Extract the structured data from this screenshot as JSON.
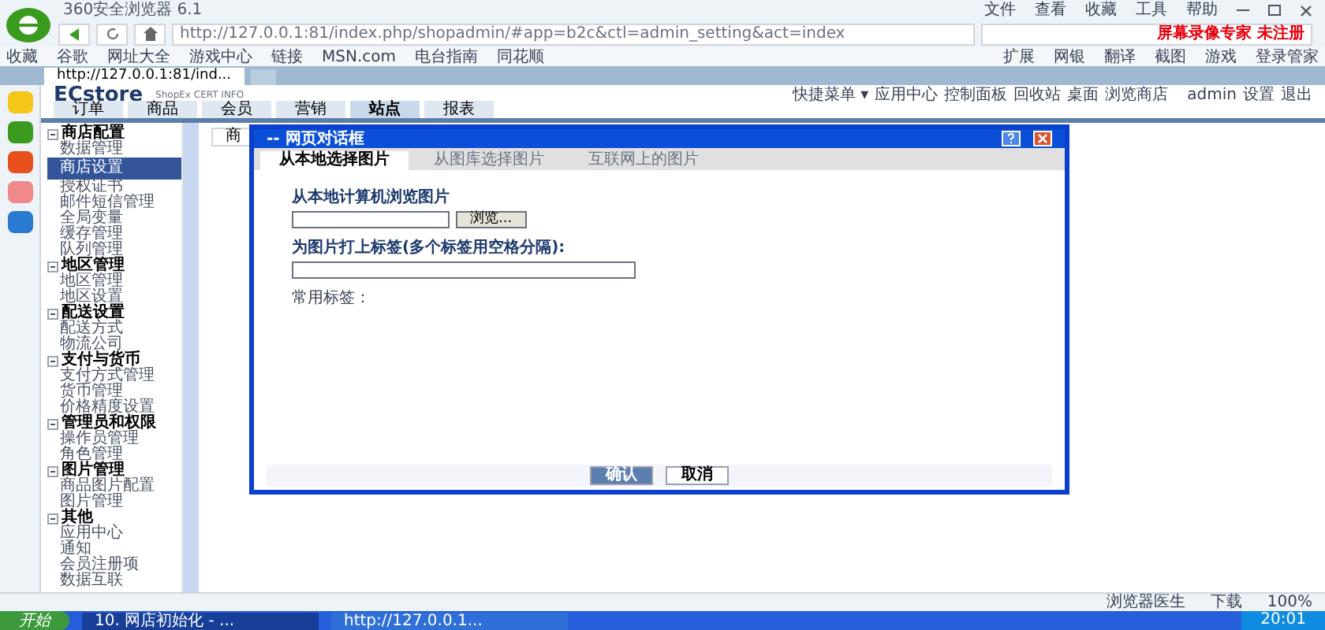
{
  "browser": {
    "title": "360安全浏览器 6.1",
    "menu": [
      "文件",
      "查看",
      "收藏",
      "工具",
      "帮助"
    ],
    "url": "http://127.0.0.1:81/index.php/shopadmin/#app=b2c&ctl=admin_setting&act=index",
    "watermark_notice": "屏幕录像专家 未注册",
    "bookmarks": [
      "收藏",
      "谷歌",
      "网址大全",
      "游戏中心",
      "链接",
      "MSN.com",
      "电台指南",
      "同花顺"
    ],
    "extensions": [
      "扩展",
      "网银",
      "翻译",
      "截图",
      "游戏",
      "登录管家"
    ],
    "tabs": [
      {
        "label": "http://127.0.0.1:81/ind...",
        "selected": true
      }
    ]
  },
  "app": {
    "logo": "ECstore",
    "logo_sub": "ShopEx CERT INFO",
    "top_links": [
      "快捷菜单 ▾",
      "应用中心",
      "控制面板",
      "回收站",
      "桌面",
      "浏览商店"
    ],
    "user": "admin",
    "user_links": [
      "设置",
      "退出"
    ],
    "nav": [
      {
        "label": "订单",
        "selected": false
      },
      {
        "label": "商品",
        "selected": false
      },
      {
        "label": "会员",
        "selected": false
      },
      {
        "label": "营销",
        "selected": false
      },
      {
        "label": "站点",
        "selected": true
      },
      {
        "label": "报表",
        "selected": false
      }
    ],
    "content_tab": "商",
    "sidebar": [
      {
        "title": "商店配置",
        "expanded": true,
        "items": [
          {
            "label": "数据管理",
            "selected": false
          },
          {
            "label": "商店设置",
            "selected": true
          },
          {
            "label": "授权证书",
            "selected": false
          },
          {
            "label": "邮件短信管理",
            "selected": false
          },
          {
            "label": "全局变量",
            "selected": false
          },
          {
            "label": "缓存管理",
            "selected": false
          },
          {
            "label": "队列管理",
            "selected": false
          }
        ]
      },
      {
        "title": "地区管理",
        "expanded": true,
        "items": [
          {
            "label": "地区管理",
            "selected": false
          },
          {
            "label": "地区设置",
            "selected": false
          }
        ]
      },
      {
        "title": "配送设置",
        "expanded": true,
        "items": [
          {
            "label": "配送方式",
            "selected": false
          },
          {
            "label": "物流公司",
            "selected": false
          }
        ]
      },
      {
        "title": "支付与货币",
        "expanded": true,
        "items": [
          {
            "label": "支付方式管理",
            "selected": false
          },
          {
            "label": "货币管理",
            "selected": false
          },
          {
            "label": "价格精度设置",
            "selected": false
          }
        ]
      },
      {
        "title": "管理员和权限",
        "expanded": true,
        "items": [
          {
            "label": "操作员管理",
            "selected": false
          },
          {
            "label": "角色管理",
            "selected": false
          }
        ]
      },
      {
        "title": "图片管理",
        "expanded": true,
        "items": [
          {
            "label": "商品图片配置",
            "selected": false
          },
          {
            "label": "图片管理",
            "selected": false
          }
        ]
      },
      {
        "title": "其他",
        "expanded": true,
        "items": [
          {
            "label": "应用中心",
            "selected": false
          },
          {
            "label": "通知",
            "selected": false
          },
          {
            "label": "会员注册项",
            "selected": false
          },
          {
            "label": "数据互联",
            "selected": false
          }
        ]
      }
    ]
  },
  "dialog": {
    "title": "-- 网页对话框",
    "tabs": [
      {
        "label": "从本地选择图片",
        "selected": true
      },
      {
        "label": "从图库选择图片",
        "selected": false
      },
      {
        "label": "互联网上的图片",
        "selected": false
      }
    ],
    "file_label": "从本地计算机浏览图片",
    "browse_button": "浏览...",
    "tags_label": "为图片打上标签(多个标签用空格分隔):",
    "common_tags": "常用标签：",
    "buttons": [
      "确认",
      "取消"
    ]
  },
  "status_bar": [
    "浏览器医生",
    "下载",
    "100%"
  ],
  "taskbar": {
    "start": "开始",
    "tasks": [
      {
        "label": "10. 网店初始化 - ...",
        "selected": true
      },
      {
        "label": "http://127.0.0.1...",
        "selected": false
      }
    ],
    "time": "20:01"
  }
}
